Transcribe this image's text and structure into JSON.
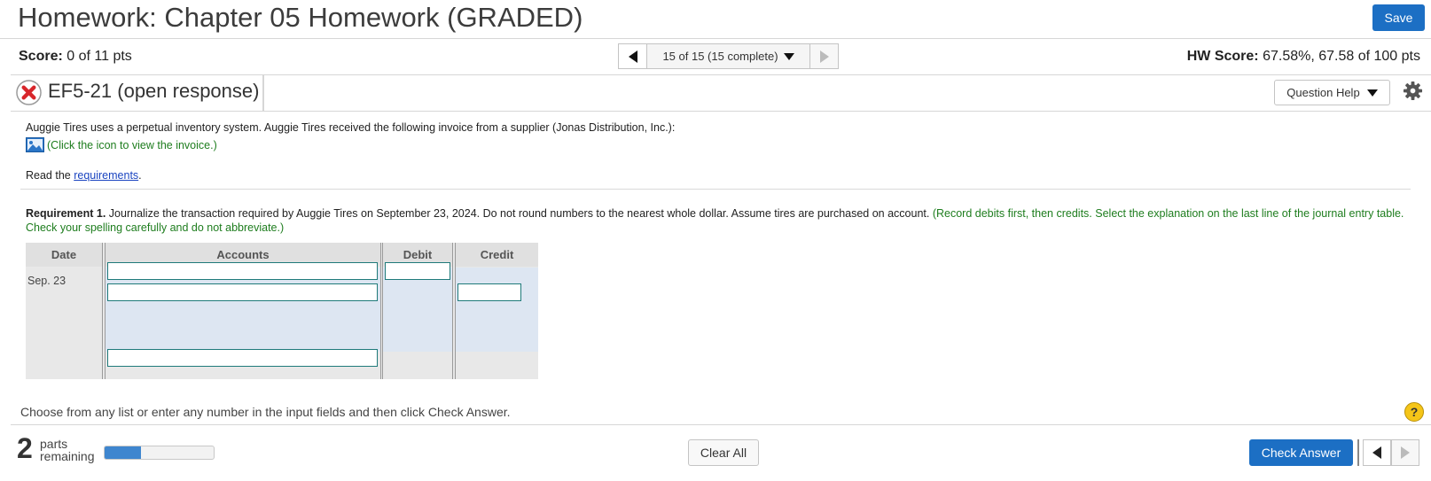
{
  "header": {
    "title": "Homework: Chapter 05 Homework (GRADED)",
    "save_label": "Save"
  },
  "score_bar": {
    "score_label": "Score:",
    "score_value": "0 of 11 pts",
    "question_position": "15 of 15 (15 complete)",
    "hw_score_label": "HW Score:",
    "hw_score_value": "67.58%, 67.58 of 100 pts"
  },
  "question": {
    "status_icon": "x-icon",
    "title": "EF5-21 (open response)",
    "help_label": "Question Help",
    "settings_icon": "gear-icon",
    "stem": "Auggie Tires uses a perpetual inventory system. Auggie Tires received the following invoice from a supplier (Jonas Distribution, Inc.):",
    "invoice_icon": "image-icon",
    "invoice_link": "(Click the icon to view the invoice.)",
    "read_prefix": "Read the",
    "read_link": "requirements",
    "read_suffix": "."
  },
  "requirement": {
    "label": "Requirement 1.",
    "text": "Journalize the transaction required by Auggie Tires on September 23, 2024. Do not round numbers to the nearest whole dollar. Assume tires are purchased on account.",
    "hint": "(Record debits first, then credits. Select the explanation on the last line of the journal entry table. Check your spelling carefully and do not abbreviate.)"
  },
  "journal": {
    "columns": [
      "Date",
      "Accounts",
      "Debit",
      "Credit"
    ],
    "date": "Sep. 23",
    "debit_account": "",
    "debit_amount": "",
    "credit_account": "",
    "credit_amount": "",
    "explanation": ""
  },
  "footer": {
    "instruction": "Choose from any list or enter any number in the input fields and then click Check Answer.",
    "help_icon": "help-circle-icon",
    "parts_count": "2",
    "parts_label_1": "parts",
    "parts_label_2": "remaining",
    "progress_fraction": 0.33,
    "clear_label": "Clear All",
    "check_label": "Check Answer"
  },
  "colors": {
    "primary_button": "#1c6fc4",
    "hint_green": "#1e7d1e",
    "link_blue": "#1a44c0",
    "error_red": "#d8262b"
  }
}
